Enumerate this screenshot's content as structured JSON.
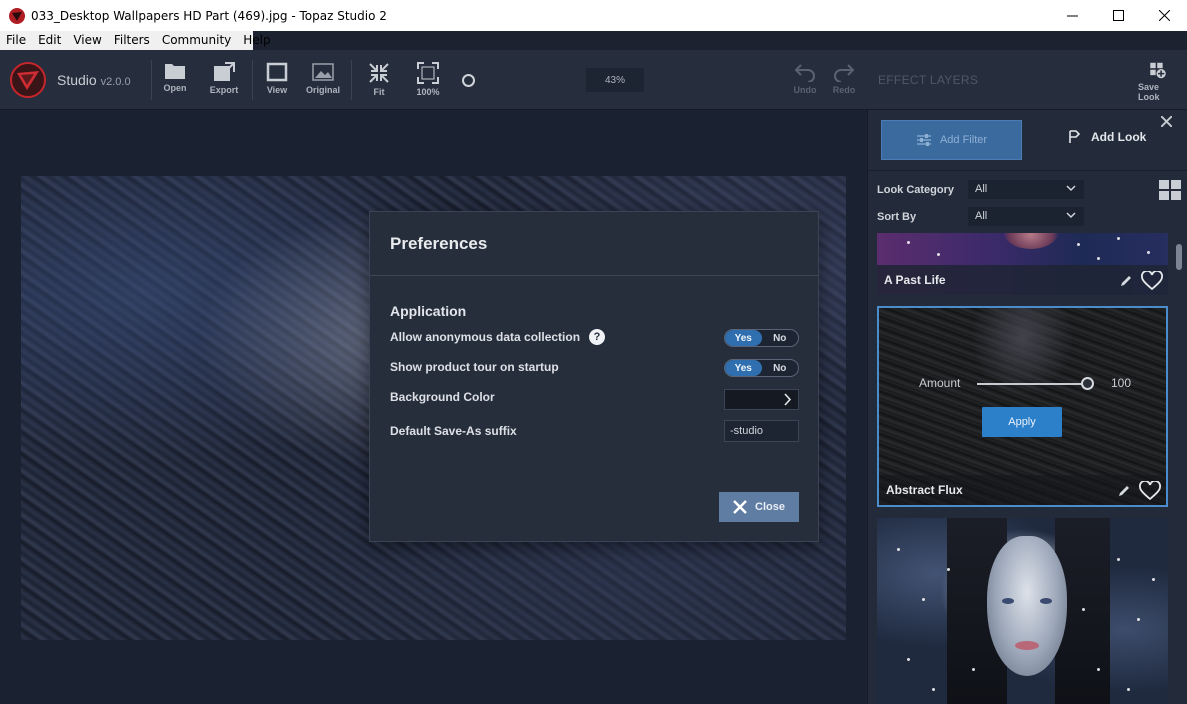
{
  "window": {
    "title": "033_Desktop Wallpapers  HD Part (469).jpg - Topaz Studio 2"
  },
  "menu": [
    "File",
    "Edit",
    "View",
    "Filters",
    "Community",
    "Help"
  ],
  "toolbar": {
    "app_name": "Studio",
    "version": "v2.0.0",
    "open": "Open",
    "export": "Export",
    "view": "View",
    "original": "Original",
    "fit": "Fit",
    "zoom100": "100%",
    "zoom_value": "43%",
    "undo": "Undo",
    "redo": "Redo",
    "effect_layers": "EFFECT LAYERS",
    "save_look": "Save Look"
  },
  "panel": {
    "add_filter": "Add Filter",
    "add_look": "Add Look",
    "look_category_label": "Look Category",
    "look_category_value": "All",
    "sort_by_label": "Sort By",
    "sort_by_value": "All",
    "looks": [
      {
        "name": "A Past Life"
      },
      {
        "name": "Abstract Flux",
        "amount_label": "Amount",
        "amount_value": "100",
        "apply": "Apply"
      },
      {
        "name": ""
      }
    ]
  },
  "preferences": {
    "title": "Preferences",
    "section": "Application",
    "anon_label": "Allow anonymous data collection",
    "anon_yes": "Yes",
    "anon_no": "No",
    "tour_label": "Show product tour on startup",
    "tour_yes": "Yes",
    "tour_no": "No",
    "bg_label": "Background Color",
    "bg_color": "#151922",
    "suffix_label": "Default Save-As suffix",
    "suffix_value": "-studio",
    "close": "Close"
  },
  "colors": {
    "accent": "#2c7fc9",
    "dialog_bg": "#262e3c",
    "toolbar_bg": "#262e3d"
  }
}
